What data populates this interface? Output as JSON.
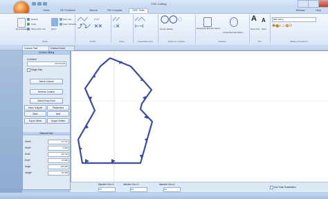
{
  "window": {
    "title": "CNC Cutting"
  },
  "tabs": [
    "Home",
    "NC Functions",
    "Macros",
    "File Compare",
    "CNC Tools",
    "Window",
    "Help"
  ],
  "active_tab": "CNC Tools",
  "ribbon": {
    "groups": [
      "Quick",
      "Profile",
      "Draw",
      "Draw Multi-Arcs",
      "Draw Arc / Circles",
      "Patterns",
      "Text",
      "Editing Transforms"
    ],
    "buttons": {
      "new_drawing": "New Drawing",
      "reload": "Reload",
      "show_cnc": "Show CNC Job",
      "zoom": "Zoom",
      "zoom_all": "Zoom All",
      "undo": "Undo",
      "zoom_window": "Zoom Window",
      "center_radius": "Center Radius",
      "rect_bolt": "Rectangular Bolt Hole Pattern",
      "circular_bolt": "Circular Bolt Hole Pattern",
      "draw_text": "Draw Text",
      "style": "Style",
      "text_field": "B52 Milling"
    }
  },
  "doc_tabs": [
    "Contour Tool",
    "Contour Knob"
  ],
  "panel": {
    "header": "Contour Milling",
    "comment_label": "Comment",
    "comment_value": "CONTOUR",
    "single_step": "Single Step",
    "buttons": [
      "Select Contour",
      "Reverse Contour",
      "Select Entry Point"
    ],
    "row1": [
      "Show Toolpath",
      "Parameters"
    ],
    "row2": [
      "Back",
      "Next"
    ],
    "row3": [
      "Export Offset",
      "Export Shifted"
    ],
    "info_header": "Element Info",
    "info": [
      {
        "label": "StartX",
        "value": "-47.712"
      },
      {
        "label": "StartY",
        "value": "0.948"
      },
      {
        "label": "EndX",
        "value": "-46.736"
      },
      {
        "label": "EndY",
        "value": "47.688"
      },
      {
        "label": "Angle",
        "value": "135.038"
      },
      {
        "label": "Length",
        "value": "46.038"
      }
    ]
  },
  "status": {
    "zero_x_label": "Machine Zero X:",
    "zero_y_label": "Machine Zero Y:",
    "zero_z_label": "Machine Zero Z:",
    "zero_x": "0.0",
    "zero_y": "0.0",
    "zero_z": "0.0",
    "tool_sub": "Use Tolan Substitution"
  },
  "colors": {
    "accent": "#4a5aa8",
    "ribbon": "#dae6f5",
    "panel": "#dfe9f6"
  }
}
